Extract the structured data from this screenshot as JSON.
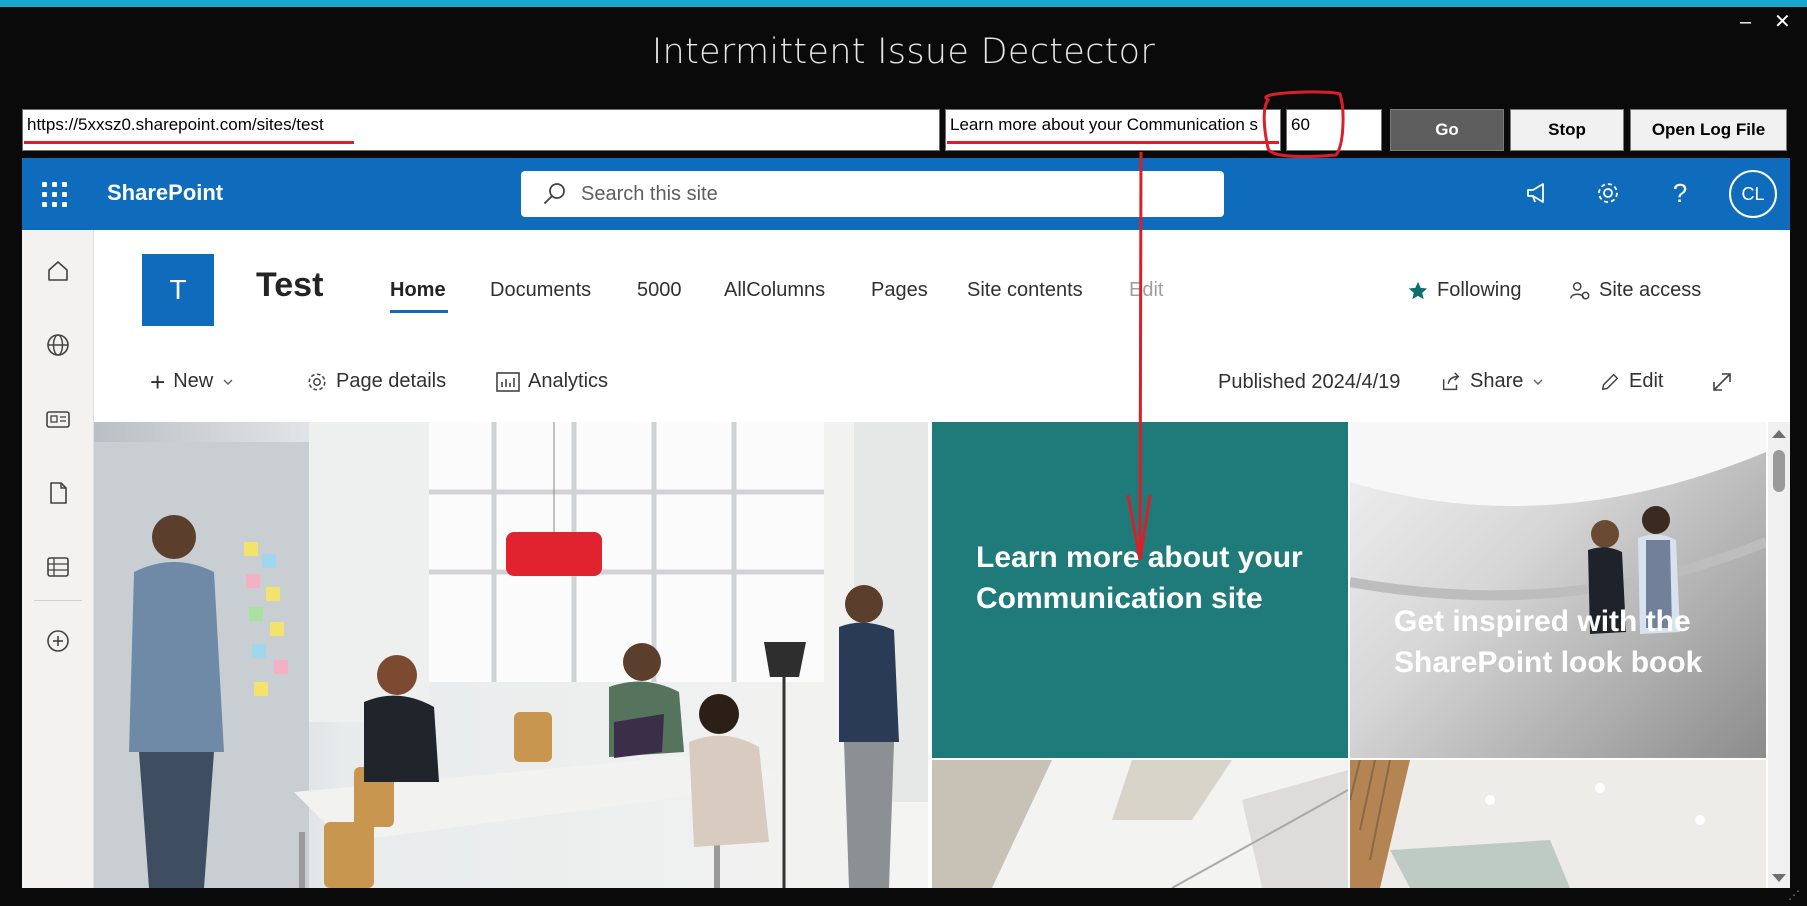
{
  "window": {
    "title": "Intermittent Issue Dectector",
    "minimize": "–",
    "close": "✕"
  },
  "toolbar": {
    "url_value": "https://5xxsz0.sharepoint.com/sites/test",
    "selector_value": "Learn more about your Communication s",
    "interval_value": "60",
    "go_label": "Go",
    "stop_label": "Stop",
    "log_label": "Open Log File"
  },
  "sharepoint": {
    "brand": "SharePoint",
    "search_placeholder": "Search this site",
    "avatar_initials": "CL",
    "accent": "#0f6cbd"
  },
  "site": {
    "logo_letter": "T",
    "title": "Test",
    "nav": [
      "Home",
      "Documents",
      "5000",
      "AllColumns",
      "Pages",
      "Site contents",
      "Edit"
    ],
    "following": "Following",
    "site_access": "Site access"
  },
  "commands": {
    "new": "New",
    "page_details": "Page details",
    "analytics": "Analytics",
    "published": "Published 2024/4/19",
    "share": "Share",
    "edit": "Edit"
  },
  "hero": {
    "tile1": "Learn more about your Communication site",
    "tile2": "Get inspired with the SharePoint look book",
    "tile1_color": "#1f7a7a"
  },
  "icons": {
    "rail": [
      "home-icon",
      "globe-icon",
      "news-icon",
      "file-icon",
      "list-icon",
      "add-icon"
    ],
    "topbar": [
      "megaphone-icon",
      "gear-icon",
      "help-icon"
    ]
  },
  "annotation_color": "#d8202a"
}
